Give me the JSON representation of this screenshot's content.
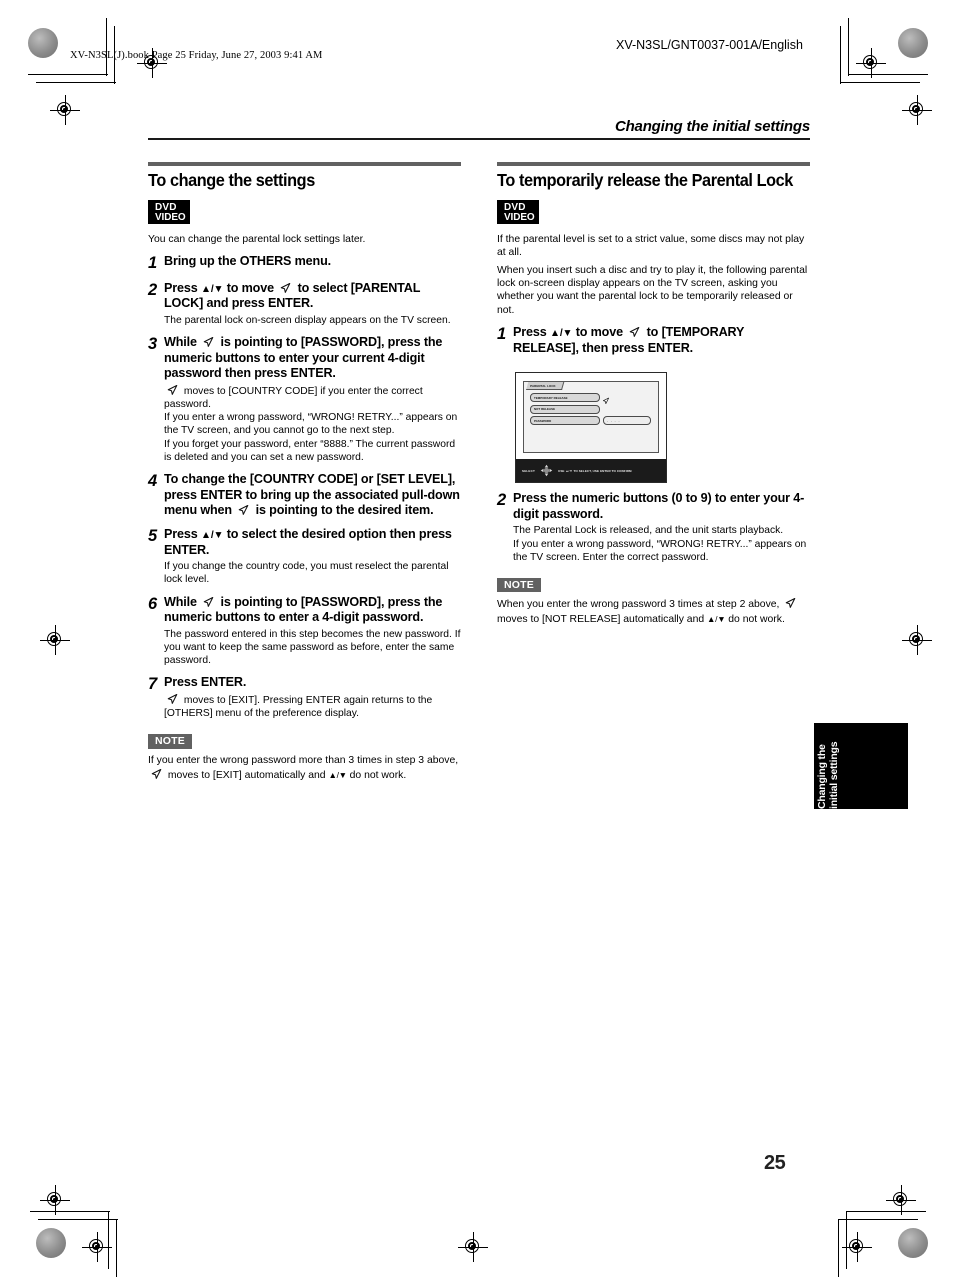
{
  "page": {
    "book_line": "XV-N3SL(J).book  Page 25  Friday, June 27, 2003  9:41 AM",
    "edition_code": "XV-N3SL/GNT0037-001A/English",
    "running_head": "Changing the initial settings",
    "page_number": "25",
    "thumb_tab_line1": "Changing the",
    "thumb_tab_line2": "initial settings"
  },
  "icons": {
    "dvd_line1": "DVD",
    "dvd_line2": "VIDEO",
    "cursor": "cursor-arrow-icon",
    "dpad": "dpad-icon"
  },
  "left_column": {
    "section_title": "To change the settings",
    "intro": "You can change the parental lock settings later.",
    "steps": [
      {
        "num": "1",
        "head_parts": [
          {
            "t": "text",
            "v": "Bring up the OTHERS menu."
          }
        ],
        "sub": []
      },
      {
        "num": "2",
        "head_parts": [
          {
            "t": "text",
            "v": "Press "
          },
          {
            "t": "updown",
            "v": "▲/▼"
          },
          {
            "t": "text",
            "v": " to move "
          },
          {
            "t": "cursor",
            "v": "cursor-arrow-icon"
          },
          {
            "t": "text",
            "v": " to select [PARENTAL LOCK] and press ENTER."
          }
        ],
        "sub": [
          {
            "t": "text",
            "v": "The parental lock on-screen display appears on the TV screen."
          }
        ]
      },
      {
        "num": "3",
        "head_parts": [
          {
            "t": "text",
            "v": "While "
          },
          {
            "t": "cursor",
            "v": "cursor-arrow-icon"
          },
          {
            "t": "text",
            "v": " is pointing to [PASSWORD], press the numeric buttons to enter your current 4-digit password then press ENTER."
          }
        ],
        "sub": [
          {
            "t": "cursor",
            "v": "cursor-arrow-icon"
          },
          {
            "t": "text",
            "v": " moves to [COUNTRY CODE] if you enter the correct password."
          },
          {
            "t": "br",
            "v": ""
          },
          {
            "t": "text",
            "v": "If you enter a wrong password, “WRONG! RETRY...” appears on the TV screen, and you cannot go to the next step."
          },
          {
            "t": "br",
            "v": ""
          },
          {
            "t": "text",
            "v": "If you forget your password, enter “8888.” The current password is deleted and you can set a new password."
          }
        ]
      },
      {
        "num": "4",
        "head_parts": [
          {
            "t": "text",
            "v": "To change the [COUNTRY CODE] or [SET LEVEL], press ENTER to bring up the associated pull-down menu when "
          },
          {
            "t": "cursor",
            "v": "cursor-arrow-icon"
          },
          {
            "t": "text",
            "v": " is pointing to the desired item."
          }
        ],
        "sub": []
      },
      {
        "num": "5",
        "head_parts": [
          {
            "t": "text",
            "v": "Press "
          },
          {
            "t": "updown",
            "v": "▲/▼"
          },
          {
            "t": "text",
            "v": " to select the desired option then press ENTER."
          }
        ],
        "sub": [
          {
            "t": "text",
            "v": "If you change the country code, you must reselect the parental lock level."
          }
        ]
      },
      {
        "num": "6",
        "head_parts": [
          {
            "t": "text",
            "v": "While "
          },
          {
            "t": "cursor",
            "v": "cursor-arrow-icon"
          },
          {
            "t": "text",
            "v": " is pointing to [PASSWORD], press the numeric buttons to enter a 4-digit password."
          }
        ],
        "sub": [
          {
            "t": "text",
            "v": "The password entered in this step becomes the new password. If you want to keep the same password as before, enter the same password."
          }
        ]
      },
      {
        "num": "7",
        "head_parts": [
          {
            "t": "text",
            "v": "Press ENTER."
          }
        ],
        "sub": [
          {
            "t": "cursor",
            "v": "cursor-arrow-icon"
          },
          {
            "t": "text",
            "v": " moves to [EXIT]. Pressing ENTER again returns to the [OTHERS] menu of the preference display."
          }
        ]
      }
    ],
    "note_label": "NOTE",
    "note_parts": [
      {
        "t": "text",
        "v": "If you enter the wrong password more than 3 times in step 3 above, "
      },
      {
        "t": "cursor",
        "v": "cursor-arrow-icon"
      },
      {
        "t": "text",
        "v": " moves to [EXIT] automatically and "
      },
      {
        "t": "updown",
        "v": "▲/▼"
      },
      {
        "t": "text",
        "v": " do not work."
      }
    ]
  },
  "right_column": {
    "section_title": "To temporarily release the Parental Lock",
    "intro_lines": [
      "If the parental level is set to a strict value, some discs may not play at all.",
      "When you insert such a disc and try to play it, the following parental lock on-screen display appears on the TV screen, asking you whether you want the parental lock to be temporarily released or not."
    ],
    "steps": [
      {
        "num": "1",
        "head_parts": [
          {
            "t": "text",
            "v": "Press "
          },
          {
            "t": "updown",
            "v": "▲/▼"
          },
          {
            "t": "text",
            "v": " to move "
          },
          {
            "t": "cursor",
            "v": "cursor-arrow-icon"
          },
          {
            "t": "text",
            "v": " to [TEMPORARY RELEASE], then press ENTER."
          }
        ],
        "sub": []
      },
      {
        "num": "2",
        "head_parts": [
          {
            "t": "text",
            "v": "Press the numeric buttons (0 to 9) to enter your 4-digit password."
          }
        ],
        "sub": [
          {
            "t": "text",
            "v": "The Parental Lock is released, and the unit starts playback."
          },
          {
            "t": "br",
            "v": ""
          },
          {
            "t": "text",
            "v": "If you enter a wrong password, “WRONG! RETRY...” appears on the TV screen. Enter the correct password."
          }
        ]
      }
    ],
    "note_label": "NOTE",
    "note_parts": [
      {
        "t": "text",
        "v": "When you enter the wrong password 3 times at step 2 above, "
      },
      {
        "t": "cursor",
        "v": "cursor-arrow-icon"
      },
      {
        "t": "text",
        "v": " moves to [NOT RELEASE] automatically and "
      },
      {
        "t": "updown",
        "v": "▲/▼"
      },
      {
        "t": "text",
        "v": " do not work."
      }
    ],
    "figure": {
      "panel_tab": "PARENTAL LOCK",
      "rows": [
        {
          "label": "TEMPORARY RELEASE",
          "value": null,
          "cursor": true
        },
        {
          "label": "NOT RELEASE",
          "value": null,
          "cursor": false
        },
        {
          "label": "PASSWORD",
          "value": "- - - -",
          "cursor": false
        }
      ],
      "bottom_label": "SELECT",
      "bottom_hint": "USE ▲/▼ TO SELECT, USE ENTER TO CONFIRM"
    }
  },
  "colors": {
    "rule_gray": "#616161",
    "rule_dark": "#1a1a1a",
    "badge_bg": "#616161",
    "tab_black": "#000000"
  }
}
